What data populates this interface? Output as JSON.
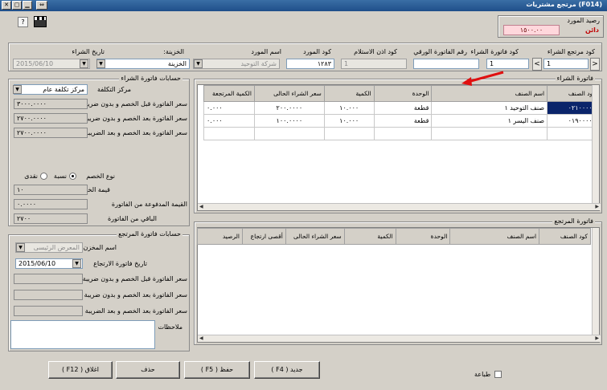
{
  "window": {
    "title": "(F014) مرتجع مشتريات"
  },
  "supplier_balance": {
    "label": "رصيد المورد",
    "value": "١٥٠٠.٠٠",
    "status": "دائن"
  },
  "header": {
    "return_code": {
      "label": "كود مرتجع الشراء",
      "value": "1"
    },
    "invoice_code": {
      "label": "كود فاتورة الشراء",
      "value": "1"
    },
    "paper_invoice": {
      "label": "رقم الفاتورة الورقي",
      "value": ""
    },
    "receipt_code": {
      "label": "كود اذن الاستلام",
      "value": "1"
    },
    "supplier_code": {
      "label": "كود المورد",
      "value": "١٢٨٣"
    },
    "supplier_name": {
      "label": "اسم المورد",
      "value": "شركة التوحيد"
    },
    "treasury": {
      "label": "الخزينة:",
      "value": "الخزينة"
    },
    "purchase_date": {
      "label": "تاريخ الشراء",
      "value": "2015/06/10"
    }
  },
  "purchase_invoice": {
    "title": "فاتورة الشراء",
    "columns": [
      "كود الصنف",
      "اسم الصنف",
      "الوحدة",
      "الكمية",
      "سعر الشراء الحالى",
      "الكمية المرتجعة"
    ],
    "rows": [
      {
        "code": "٠٢١٠٠٠٠١",
        "name": "صنف التوحيد ١",
        "unit": "قطعة",
        "qty": "١٠.٠٠٠",
        "price": "٢٠٠.٠٠٠٠",
        "ret": "٠.٠٠٠"
      },
      {
        "code": "٠١٩٠٠٠٠١",
        "name": "صنف اليسر ١",
        "unit": "قطعة",
        "qty": "١٠.٠٠٠",
        "price": "١٠٠.٠٠٠٠",
        "ret": "٠.٠٠٠"
      }
    ]
  },
  "invoice_accounts": {
    "title": "حسابات فاتورة الشراء",
    "cost_center": {
      "label": "مركز التكلفة",
      "value": "مركز تكلفة عام"
    },
    "before_disc": {
      "label": "سعر الفاتورة قبل الخصم و بدون ضريبة",
      "value": "٣٠٠٠.٠٠٠٠"
    },
    "after_disc": {
      "label": "سعر الفاتورة بعد الخصم و بدون ضريبة",
      "value": "٢٧٠٠.٠٠٠٠"
    },
    "after_tax": {
      "label": "سعر الفاتورة بعد الخصم و بعد الضريبة",
      "value": "٢٧٠٠.٠٠٠٠"
    },
    "discount_type": {
      "label": "نوع الخصم",
      "percent": "نسبة",
      "cash": "نقدى"
    },
    "discount_value": {
      "label": "قيمة الخصم",
      "value": "١٠"
    },
    "paid": {
      "label": "القيمة المدفوعة من الفاتورة",
      "value": "٠.٠٠٠٠"
    },
    "remaining": {
      "label": "الباقي من الفاتورة",
      "value": "٢٧٠٠"
    }
  },
  "return_invoice": {
    "title": "فاتورة المرتجع",
    "columns": [
      "كود الصنف",
      "اسم الصنف",
      "الوحدة",
      "الكمية",
      "سعر الشراء الحالى",
      "أقصى ارتجاع",
      "الرصيد"
    ]
  },
  "return_accounts": {
    "title": "حسابات فاتورة المرتجع",
    "store": {
      "label": "اسم المخزن",
      "value": "المعرض الرئيسى"
    },
    "return_date": {
      "label": "تاريخ فاتورة الارتجاع",
      "value": "2015/06/10"
    },
    "before_disc": {
      "label": "سعر الفاتورة قبل الخصم و بدون ضريبة",
      "value": ""
    },
    "after_disc": {
      "label": "سعر الفاتورة بعد الخصم و بدون ضريبة",
      "value": ""
    },
    "after_tax": {
      "label": "سعر الفاتورة بعد الخصم و بعد الضريبة",
      "value": ""
    },
    "notes": {
      "label": "ملاحظات",
      "value": ""
    }
  },
  "footer": {
    "print": "طباعة",
    "new": "جديد ( F4 )",
    "save": "حفظ ( F5 )",
    "delete": "حذف",
    "close": "اغلاق ( F12 )"
  }
}
